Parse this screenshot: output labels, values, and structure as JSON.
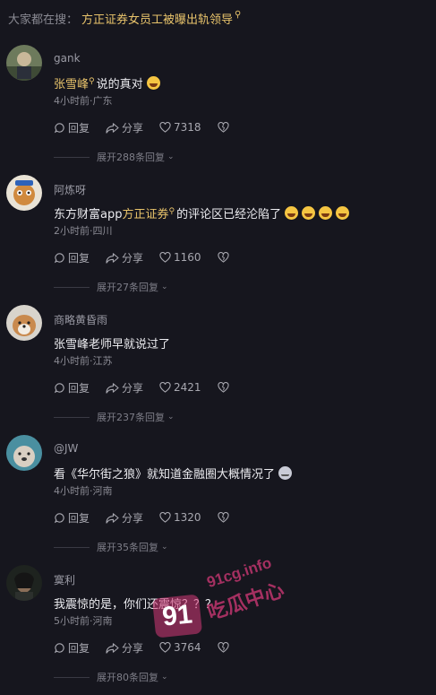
{
  "search_bar": {
    "prefix": "大家都在搜：",
    "query": "方正证券女员工被曝出轨领导",
    "query_icon": "search-icon"
  },
  "comments": [
    {
      "username": "gank",
      "text_pre": "",
      "mention": "张雪峰",
      "text_post": "说的真对",
      "emojis": [
        "grinning-sweat-emoji"
      ],
      "meta": "4小时前·广东",
      "reply_label": "回复",
      "share_label": "分享",
      "likes": "7318",
      "expand_label": "展开288条回复"
    },
    {
      "username": "阿炼呀",
      "text_pre": "东方财富app",
      "mention": "方正证券",
      "text_post": "的评论区已经沦陷了",
      "emojis": [
        "rolling-laugh-emoji",
        "rolling-laugh-emoji",
        "rolling-laugh-emoji",
        "rolling-laugh-emoji"
      ],
      "meta": "2小时前·四川",
      "reply_label": "回复",
      "share_label": "分享",
      "likes": "1160",
      "expand_label": "展开27条回复"
    },
    {
      "username": "商略黄昏雨",
      "text_pre": "张雪峰老师早就说过了",
      "mention": "",
      "text_post": "",
      "emojis": [],
      "meta": "4小时前·江苏",
      "reply_label": "回复",
      "share_label": "分享",
      "likes": "2421",
      "expand_label": "展开237条回复"
    },
    {
      "username": "@JW",
      "text_pre": "看《华尔街之狼》就知道金融圈大概情况了",
      "mention": "",
      "text_post": "",
      "emojis": [
        "cat-emoji"
      ],
      "meta": "4小时前·河南",
      "reply_label": "回复",
      "share_label": "分享",
      "likes": "1320",
      "expand_label": "展开35条回复"
    },
    {
      "username": "寞利",
      "text_pre": "我震惊的是，你们还震惊？？？",
      "mention": "",
      "text_post": "",
      "emojis": [],
      "meta": "5小时前·河南",
      "reply_label": "回复",
      "share_label": "分享",
      "likes": "3764",
      "expand_label": "展开80条回复"
    }
  ],
  "watermark": {
    "badge": "91",
    "url": "91cg.info",
    "name": "吃瓜中心"
  }
}
